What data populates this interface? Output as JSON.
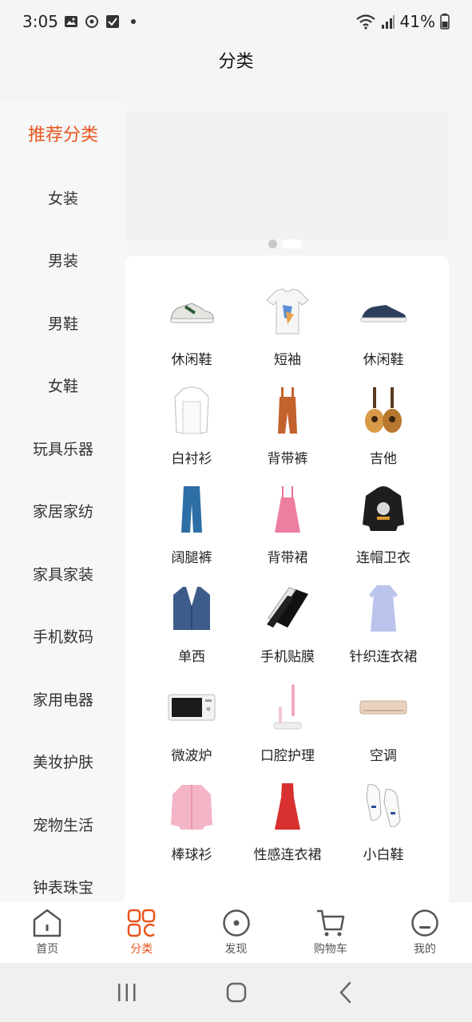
{
  "status_bar": {
    "time": "3:05",
    "battery": "41%",
    "icons_left": [
      "image-icon",
      "sync-icon",
      "checkbox-icon",
      "dot-icon"
    ],
    "icons_right": [
      "wifi-icon",
      "signal-icon",
      "battery-icon"
    ]
  },
  "header": {
    "title": "分类"
  },
  "sidebar": {
    "items": [
      {
        "label": "推荐分类",
        "active": true
      },
      {
        "label": "女装"
      },
      {
        "label": "男装"
      },
      {
        "label": "男鞋"
      },
      {
        "label": "女鞋"
      },
      {
        "label": "玩具乐器"
      },
      {
        "label": "家居家纺"
      },
      {
        "label": "家具家装"
      },
      {
        "label": "手机数码"
      },
      {
        "label": "家用电器"
      },
      {
        "label": "美妆护肤"
      },
      {
        "label": "宠物生活"
      },
      {
        "label": "钟表珠宝"
      }
    ]
  },
  "banner": {
    "page_count": 2,
    "current_page": 2
  },
  "categories": [
    {
      "label": "休闲鞋",
      "icon": "sneaker-icon"
    },
    {
      "label": "短袖",
      "icon": "tshirt-icon"
    },
    {
      "label": "休闲鞋",
      "icon": "canvas-shoe-icon"
    },
    {
      "label": "白衬衫",
      "icon": "white-shirt-icon"
    },
    {
      "label": "背带裤",
      "icon": "overalls-icon"
    },
    {
      "label": "吉他",
      "icon": "guitar-icon"
    },
    {
      "label": "阔腿裤",
      "icon": "wide-pants-icon"
    },
    {
      "label": "背带裙",
      "icon": "pinafore-dress-icon"
    },
    {
      "label": "连帽卫衣",
      "icon": "hoodie-icon"
    },
    {
      "label": "单西",
      "icon": "blazer-icon"
    },
    {
      "label": "手机贴膜",
      "icon": "screen-protector-icon"
    },
    {
      "label": "针织连衣裙",
      "icon": "knit-dress-icon"
    },
    {
      "label": "微波炉",
      "icon": "microwave-icon"
    },
    {
      "label": "口腔护理",
      "icon": "toothbrush-icon"
    },
    {
      "label": "空调",
      "icon": "air-conditioner-icon"
    },
    {
      "label": "棒球衫",
      "icon": "baseball-jacket-icon"
    },
    {
      "label": "性感连衣裙",
      "icon": "red-dress-icon"
    },
    {
      "label": "小白鞋",
      "icon": "white-sneaker-icon"
    }
  ],
  "tabbar": {
    "items": [
      {
        "label": "首页",
        "icon": "home-icon"
      },
      {
        "label": "分类",
        "icon": "category-icon",
        "active": true
      },
      {
        "label": "发现",
        "icon": "discover-icon"
      },
      {
        "label": "购物车",
        "icon": "cart-icon"
      },
      {
        "label": "我的",
        "icon": "profile-icon"
      }
    ]
  },
  "colors": {
    "accent": "#e8541c",
    "background": "#f5f5f5",
    "panel": "#ffffff"
  }
}
